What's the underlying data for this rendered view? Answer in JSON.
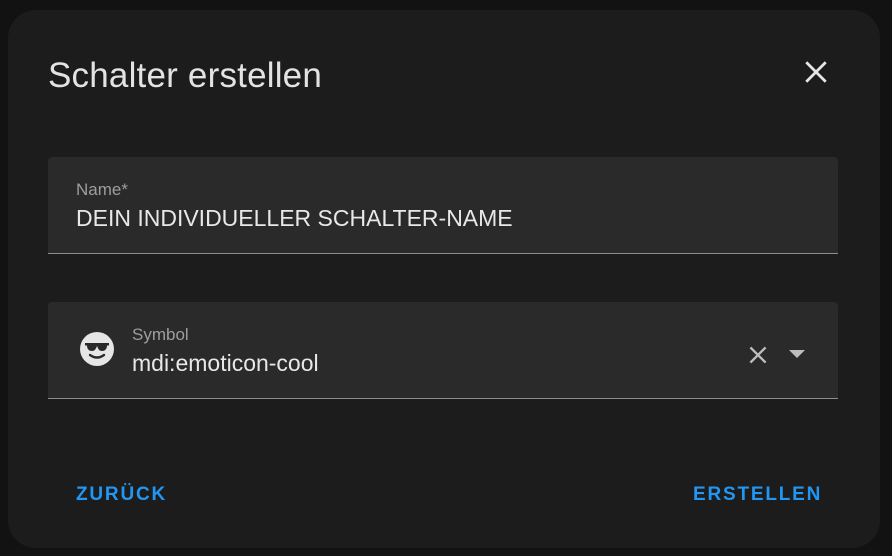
{
  "dialog": {
    "title": "Schalter erstellen",
    "close_icon": "close-icon"
  },
  "name_field": {
    "label": "Name*",
    "value": "DEIN INDIVIDUELLER SCHALTER-NAME"
  },
  "symbol_field": {
    "label": "Symbol",
    "value": "mdi:emoticon-cool",
    "icon": "emoticon-cool-icon",
    "clear_icon": "clear-icon",
    "dropdown_icon": "chevron-down-icon"
  },
  "actions": {
    "back_label": "ZURÜCK",
    "create_label": "ERSTELLEN"
  },
  "colors": {
    "surface": "#1c1c1c",
    "field_background": "#2a2a2a",
    "accent": "#2196f3",
    "text_primary": "#e8e8e8",
    "text_secondary": "#9e9e9e"
  }
}
